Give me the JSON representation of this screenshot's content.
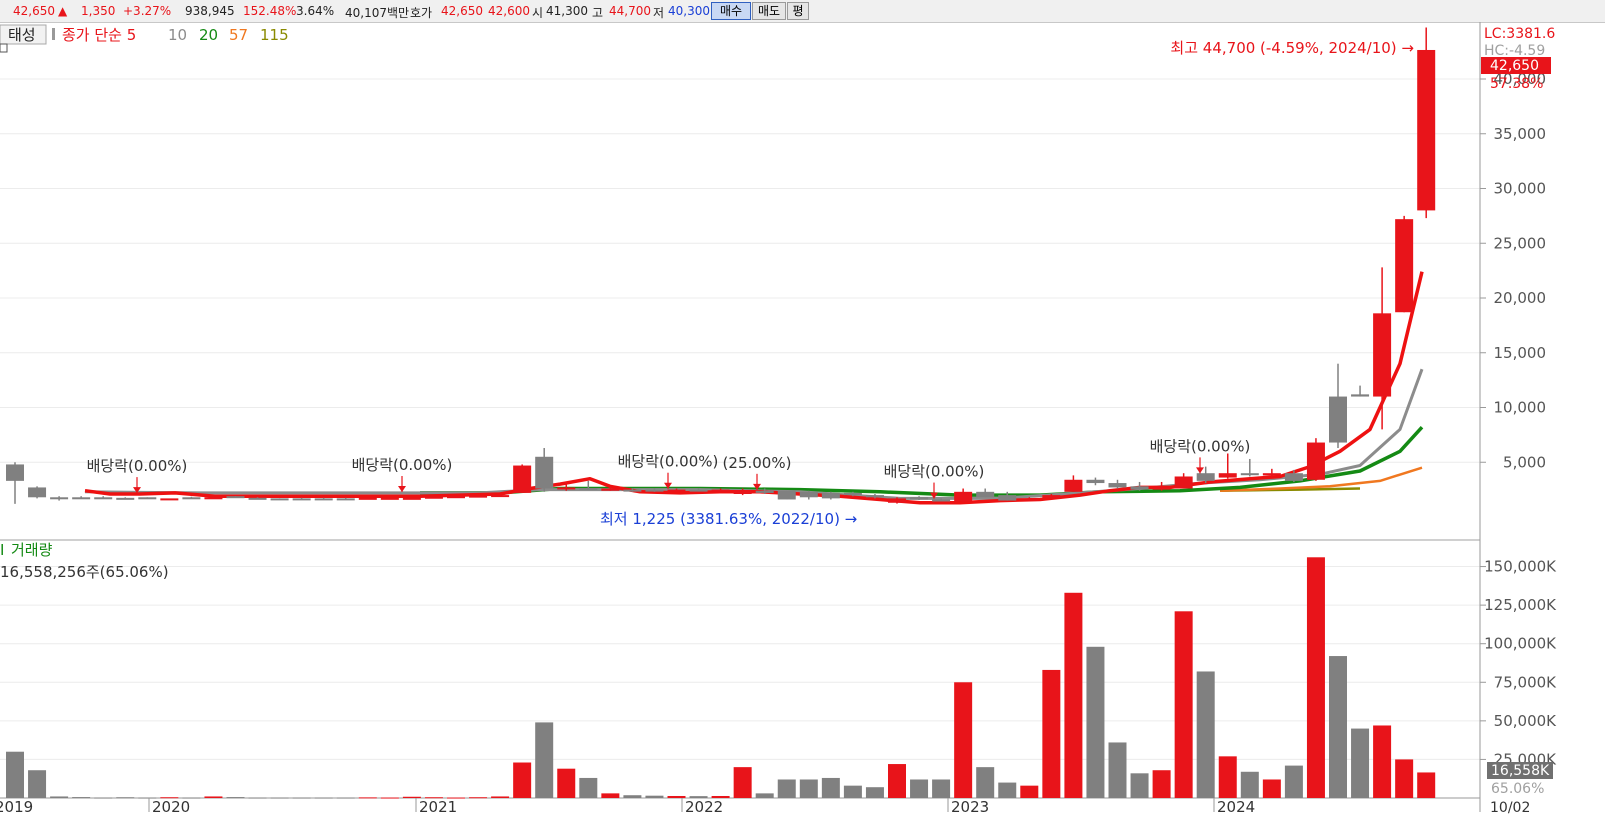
{
  "quote": {
    "price": "42,650",
    "arrow": "▲",
    "change": "1,350",
    "change_pct": "+3.27%",
    "volume": "938,945",
    "vol_ratio": "152.48%",
    "turnover": "3.64%",
    "amount": "40,107백만",
    "hoga_label": "호가",
    "ask": "42,650",
    "bid": "42,600",
    "open_label": "시",
    "open": "41,300",
    "high_label": "고",
    "high": "44,700",
    "low_label": "저",
    "low": "40,300",
    "buy_btn": "매수",
    "sell_btn": "매도",
    "eval_btn": "평"
  },
  "legend": {
    "stock_name": "태성",
    "ma_title": "종가 단순 5",
    "ma10": "10",
    "ma20": "20",
    "ma57": "57",
    "ma115": "115"
  },
  "annotations": {
    "high": "최고 44,700 (-4.59%, 2024/10) →",
    "low": "최저 1,225 (3381.63%, 2022/10) →",
    "dividend": "배당락(0.00%)",
    "rights": "(25.00%)"
  },
  "right_axis": {
    "lc": "LC:3381.6",
    "hc": "HC:-4.59",
    "price_box": "42,650",
    "price_pct": "57.38%",
    "vol_box": "16,558K",
    "vol_pct": "65.06%",
    "last_date": "10/02"
  },
  "volume_panel": {
    "title": "거래량",
    "value": "16,558,256주(65.06%)"
  },
  "colors": {
    "up": "#e8141a",
    "down": "#808080",
    "ma5": "#ee1111",
    "ma10": "#8c8c8c",
    "ma20": "#148a14",
    "ma57": "#f07820",
    "ma115": "#8a8a00",
    "low_text": "#1a3fd6"
  },
  "chart_data": {
    "type": "candlestick",
    "x_labels": [
      "2019",
      "2020",
      "2021",
      "2022",
      "2023",
      "2024"
    ],
    "price_ticks": [
      5000,
      10000,
      15000,
      20000,
      25000,
      30000,
      35000,
      40000
    ],
    "volume_ticks": [
      "25,000K",
      "50,000K",
      "75,000K",
      "100,000K",
      "125,000K",
      "150,000K"
    ],
    "ylim": [
      0,
      48300
    ],
    "vol_ylim": [
      0,
      170000
    ],
    "candles": [
      [
        3300,
        4800,
        3300,
        5000,
        1200,
        "d",
        30000
      ],
      [
        1800,
        2700,
        1800,
        2800,
        1700,
        "d",
        18000
      ],
      [
        1700,
        1800,
        1600,
        1900,
        1500,
        "d",
        1000
      ],
      [
        1700,
        1800,
        1700,
        1900,
        1700,
        "d",
        600
      ],
      [
        1700,
        1800,
        1650,
        1900,
        1650,
        "d",
        300
      ],
      [
        1700,
        1750,
        1650,
        1800,
        1650,
        "d",
        500
      ],
      [
        1700,
        1800,
        1650,
        1800,
        1650,
        "d",
        300
      ],
      [
        1700,
        1700,
        1700,
        1700,
        1700,
        "u",
        500
      ],
      [
        1800,
        1800,
        1750,
        1850,
        1750,
        "d",
        300
      ],
      [
        1800,
        1800,
        1750,
        1850,
        1750,
        "u",
        1000
      ],
      [
        1750,
        1900,
        1750,
        1900,
        1750,
        "d",
        600
      ],
      [
        1650,
        1750,
        1650,
        1800,
        1650,
        "d",
        300
      ],
      [
        1650,
        1700,
        1650,
        1700,
        1600,
        "d",
        300
      ],
      [
        1650,
        1700,
        1650,
        1750,
        1650,
        "d",
        300
      ],
      [
        1650,
        1700,
        1650,
        1750,
        1650,
        "d",
        300
      ],
      [
        1650,
        1700,
        1650,
        1750,
        1650,
        "d",
        300
      ],
      [
        1700,
        1750,
        1700,
        1750,
        1700,
        "u",
        400
      ],
      [
        1700,
        1750,
        1700,
        1750,
        1700,
        "u",
        300
      ],
      [
        1700,
        1750,
        1700,
        1750,
        1700,
        "u",
        800
      ],
      [
        1800,
        1850,
        1800,
        1850,
        1800,
        "u",
        500
      ],
      [
        1850,
        1900,
        1850,
        1900,
        1850,
        "u",
        300
      ],
      [
        1900,
        1950,
        1900,
        1950,
        1900,
        "u",
        500
      ],
      [
        1900,
        2000,
        1900,
        2000,
        1900,
        "u",
        1000
      ],
      [
        2200,
        4700,
        2200,
        4800,
        2200,
        "u",
        23000
      ],
      [
        5500,
        2600,
        2500,
        6300,
        2300,
        "d",
        49000
      ],
      [
        2600,
        2700,
        2500,
        3200,
        2400,
        "u",
        19000
      ],
      [
        2600,
        2650,
        2500,
        3300,
        2500,
        "d",
        13000
      ],
      [
        2400,
        2600,
        2400,
        2800,
        2400,
        "u",
        3000
      ],
      [
        2500,
        2400,
        2400,
        2600,
        2300,
        "d",
        1800
      ],
      [
        2400,
        2500,
        2400,
        2600,
        2300,
        "d",
        1500
      ],
      [
        2500,
        2450,
        2400,
        2600,
        2400,
        "u",
        1300
      ],
      [
        2450,
        2500,
        2400,
        2600,
        2400,
        "d",
        1200
      ],
      [
        2500,
        2450,
        2400,
        2600,
        2400,
        "u",
        1300
      ],
      [
        2450,
        2100,
        2000,
        2600,
        2000,
        "u",
        20000
      ],
      [
        2400,
        2200,
        2100,
        2600,
        2100,
        "d",
        3000
      ],
      [
        2400,
        1600,
        1600,
        2400,
        1600,
        "d",
        12000
      ],
      [
        2300,
        1800,
        1600,
        2400,
        1600,
        "d",
        12000
      ],
      [
        2200,
        1700,
        1600,
        2300,
        1600,
        "d",
        13000
      ],
      [
        2200,
        2000,
        1900,
        2300,
        1900,
        "d",
        8000
      ],
      [
        2000,
        1800,
        1700,
        2100,
        1700,
        "d",
        7000
      ],
      [
        1700,
        1300,
        1225,
        1800,
        1225,
        "u",
        22000
      ],
      [
        1800,
        1600,
        1550,
        1900,
        1550,
        "d",
        12000
      ],
      [
        1600,
        1500,
        1450,
        1700,
        1450,
        "d",
        12000
      ],
      [
        1400,
        2300,
        1300,
        2600,
        1300,
        "u",
        75000
      ],
      [
        2300,
        1800,
        1800,
        2600,
        1800,
        "d",
        20000
      ],
      [
        2000,
        1500,
        1500,
        2300,
        1500,
        "d",
        10000
      ],
      [
        1500,
        1700,
        1500,
        1800,
        1500,
        "u",
        8000
      ],
      [
        1700,
        2000,
        1700,
        2100,
        1700,
        "u",
        83000
      ],
      [
        2300,
        3400,
        2300,
        3800,
        2300,
        "u",
        133000
      ],
      [
        3400,
        3100,
        3000,
        3600,
        2900,
        "d",
        98000
      ],
      [
        3100,
        2700,
        2700,
        3400,
        2600,
        "d",
        36000
      ],
      [
        2800,
        2500,
        2500,
        3200,
        2400,
        "d",
        16000
      ],
      [
        2500,
        2700,
        2500,
        3200,
        2400,
        "u",
        18000
      ],
      [
        2600,
        3700,
        2600,
        4000,
        2600,
        "u",
        121000
      ],
      [
        4000,
        3300,
        3300,
        4600,
        3100,
        "d",
        82000
      ],
      [
        3600,
        4000,
        3600,
        5800,
        3500,
        "u",
        27000
      ],
      [
        4000,
        3900,
        3800,
        5300,
        3700,
        "d",
        17000
      ],
      [
        3800,
        4000,
        3700,
        4400,
        3600,
        "u",
        12000
      ],
      [
        4000,
        3300,
        3200,
        4300,
        3200,
        "d",
        21000
      ],
      [
        3400,
        6800,
        3400,
        7200,
        3300,
        "u",
        156000
      ],
      [
        11000,
        6800,
        6300,
        14000,
        6300,
        "d",
        92000
      ],
      [
        11000,
        11200,
        11000,
        12000,
        11000,
        "d",
        45000
      ],
      [
        11000,
        18600,
        8000,
        22800,
        8000,
        "u",
        47000
      ],
      [
        18700,
        27200,
        18700,
        27500,
        18700,
        "u",
        25000
      ],
      [
        28000,
        42650,
        27300,
        44700,
        27300,
        "u",
        16558
      ]
    ],
    "ma5": [
      [
        85,
        2400
      ],
      [
        110,
        2100
      ],
      [
        140,
        2100
      ],
      [
        175,
        2200
      ],
      [
        215,
        1900
      ],
      [
        260,
        1900
      ],
      [
        300,
        1900
      ],
      [
        340,
        1900
      ],
      [
        380,
        1900
      ],
      [
        420,
        1900
      ],
      [
        460,
        2000
      ],
      [
        500,
        2100
      ],
      [
        530,
        2600
      ],
      [
        560,
        3000
      ],
      [
        590,
        3500
      ],
      [
        610,
        2800
      ],
      [
        640,
        2300
      ],
      [
        680,
        2200
      ],
      [
        720,
        2300
      ],
      [
        760,
        2300
      ],
      [
        800,
        2100
      ],
      [
        840,
        1900
      ],
      [
        880,
        1600
      ],
      [
        920,
        1300
      ],
      [
        960,
        1300
      ],
      [
        1000,
        1500
      ],
      [
        1040,
        1600
      ],
      [
        1080,
        2000
      ],
      [
        1110,
        2400
      ],
      [
        1140,
        2700
      ],
      [
        1170,
        2700
      ],
      [
        1210,
        3200
      ],
      [
        1250,
        3500
      ],
      [
        1280,
        3700
      ],
      [
        1310,
        4600
      ],
      [
        1340,
        6000
      ],
      [
        1370,
        8000
      ],
      [
        1400,
        14000
      ],
      [
        1422,
        22400
      ]
    ],
    "ma10": [
      [
        85,
        2300
      ],
      [
        200,
        2200
      ],
      [
        300,
        2200
      ],
      [
        420,
        2200
      ],
      [
        480,
        2200
      ],
      [
        540,
        2500
      ],
      [
        600,
        2500
      ],
      [
        700,
        2500
      ],
      [
        800,
        2300
      ],
      [
        900,
        1700
      ],
      [
        1000,
        1700
      ],
      [
        1080,
        2200
      ],
      [
        1140,
        2600
      ],
      [
        1200,
        3100
      ],
      [
        1260,
        3400
      ],
      [
        1320,
        3900
      ],
      [
        1360,
        4700
      ],
      [
        1400,
        8000
      ],
      [
        1422,
        13500
      ]
    ],
    "ma20": [
      [
        420,
        2200
      ],
      [
        500,
        2200
      ],
      [
        560,
        2600
      ],
      [
        620,
        2600
      ],
      [
        700,
        2600
      ],
      [
        800,
        2500
      ],
      [
        880,
        2300
      ],
      [
        960,
        2000
      ],
      [
        1040,
        2000
      ],
      [
        1100,
        2300
      ],
      [
        1180,
        2400
      ],
      [
        1240,
        2700
      ],
      [
        1300,
        3300
      ],
      [
        1360,
        4200
      ],
      [
        1400,
        6000
      ],
      [
        1422,
        8200
      ]
    ],
    "ma57": [
      [
        1220,
        2400
      ],
      [
        1280,
        2600
      ],
      [
        1330,
        2800
      ],
      [
        1380,
        3300
      ],
      [
        1422,
        4500
      ]
    ],
    "ma115": [
      [
        1220,
        2400
      ],
      [
        1300,
        2500
      ],
      [
        1360,
        2600
      ]
    ],
    "dividend_marks": [
      {
        "x": 137,
        "price": 2000
      },
      {
        "x": 402,
        "price": 2100
      },
      {
        "x": 668,
        "price": 2400
      },
      {
        "x": 934,
        "price": 1500
      },
      {
        "x": 1200,
        "price": 3800
      }
    ],
    "rights_mark": {
      "x": 757,
      "price": 2300
    }
  }
}
